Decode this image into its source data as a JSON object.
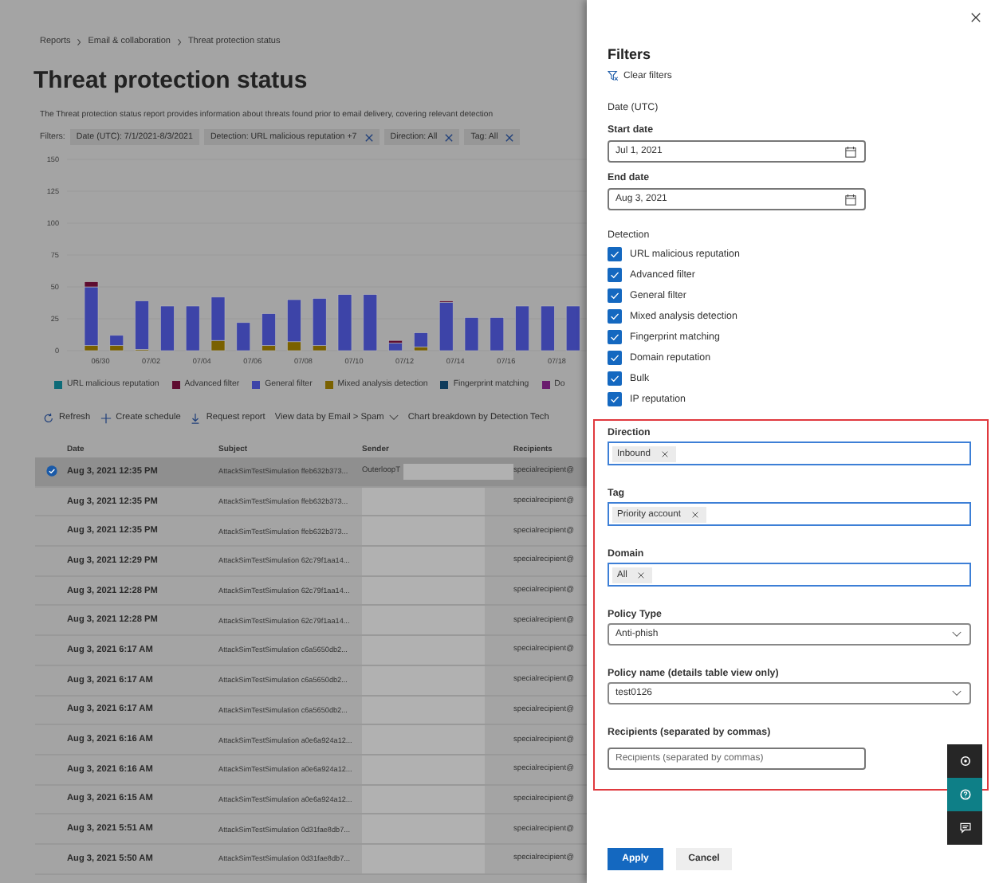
{
  "breadcrumb": [
    "Reports",
    "Email & collaboration",
    "Threat protection status"
  ],
  "page": {
    "title": "Threat protection status",
    "description": "The Threat protection status report provides information about threats found prior to email delivery, covering relevant detection"
  },
  "filters": {
    "label": "Filters:",
    "chips": [
      {
        "label": "Date (UTC): 7/1/2021-8/3/2021",
        "removable": false
      },
      {
        "label": "Detection: URL malicious reputation +7",
        "removable": true
      },
      {
        "label": "Direction: All",
        "removable": true
      },
      {
        "label": "Tag: All",
        "removable": true
      }
    ]
  },
  "chart": {
    "chart_data": {
      "type": "bar",
      "stacked": true,
      "categories": [
        "06/30",
        null,
        "07/02",
        null,
        "07/04",
        null,
        "07/06",
        null,
        "07/08",
        null,
        "07/10",
        null,
        "07/12",
        null,
        "07/14",
        null,
        "07/16",
        null,
        "07/18",
        null
      ],
      "ylim": [
        0,
        150
      ],
      "yticks": [
        0,
        25,
        50,
        75,
        100,
        125,
        150
      ],
      "series": [
        {
          "name": "URL malicious reputation",
          "color": "#0e6b78",
          "values": [
            0,
            0,
            0,
            0,
            0,
            0,
            0,
            0,
            0,
            0,
            0,
            0,
            0,
            0,
            0,
            0,
            0,
            0,
            0,
            0
          ]
        },
        {
          "name": "Advanced filter",
          "color": "#5e0c30",
          "values": [
            4,
            0,
            0,
            0,
            0,
            0,
            0,
            0,
            0,
            0,
            0,
            0,
            2,
            0,
            1,
            0,
            0,
            0,
            0,
            0
          ]
        },
        {
          "name": "General filter",
          "color": "#3d44a8",
          "values": [
            46,
            8,
            38,
            35,
            35,
            34,
            22,
            25,
            33,
            37,
            44,
            44,
            6,
            11,
            38,
            26,
            26,
            35,
            35,
            35
          ]
        },
        {
          "name": "Mixed analysis detection",
          "color": "#7a6100",
          "values": [
            4,
            4,
            1,
            0,
            0,
            8,
            0,
            4,
            7,
            4,
            0,
            0,
            0,
            3,
            0,
            0,
            0,
            0,
            0,
            0
          ]
        },
        {
          "name": "Fingerprint matching",
          "color": "#103c5c",
          "values": [
            0,
            0,
            0,
            0,
            0,
            0,
            0,
            0,
            0,
            0,
            0,
            0,
            0,
            0,
            0,
            0,
            0,
            0,
            0,
            0
          ]
        },
        {
          "name": "Do",
          "color": "#6a1c6e",
          "values": [
            0,
            0,
            0,
            0,
            0,
            0,
            0,
            0,
            0,
            0,
            0,
            0,
            0,
            0,
            0,
            0,
            0,
            0,
            0,
            0
          ]
        }
      ]
    }
  },
  "toolbar": [
    {
      "kind": "refresh",
      "label": "Refresh"
    },
    {
      "kind": "add",
      "label": "Create schedule"
    },
    {
      "kind": "download",
      "label": "Request report"
    },
    {
      "kind": "dropdown",
      "label": "View data by Email > Spam"
    },
    {
      "kind": "plain",
      "label": "Chart breakdown by Detection Tech"
    }
  ],
  "table": {
    "columns": [
      "Date",
      "Subject",
      "Sender",
      "Recipients"
    ],
    "rows": [
      {
        "selected": true,
        "date": "Aug 3, 2021 12:35 PM",
        "subject": "AttackSimTestSimulation ffeb632b373...",
        "sender": "OuterloopT",
        "recipients": "specialrecipient@"
      },
      {
        "selected": false,
        "date": "Aug 3, 2021 12:35 PM",
        "subject": "AttackSimTestSimulation ffeb632b373...",
        "recipients": "specialrecipient@"
      },
      {
        "selected": false,
        "date": "Aug 3, 2021 12:35 PM",
        "subject": "AttackSimTestSimulation ffeb632b373...",
        "recipients": "specialrecipient@"
      },
      {
        "selected": false,
        "date": "Aug 3, 2021 12:29 PM",
        "subject": "AttackSimTestSimulation 62c79f1aa14...",
        "recipients": "specialrecipient@"
      },
      {
        "selected": false,
        "date": "Aug 3, 2021 12:28 PM",
        "subject": "AttackSimTestSimulation 62c79f1aa14...",
        "recipients": "specialrecipient@"
      },
      {
        "selected": false,
        "date": "Aug 3, 2021 12:28 PM",
        "subject": "AttackSimTestSimulation 62c79f1aa14...",
        "recipients": "specialrecipient@"
      },
      {
        "selected": false,
        "date": "Aug 3, 2021 6:17 AM",
        "subject": "AttackSimTestSimulation c6a5650db2...",
        "recipients": "specialrecipient@"
      },
      {
        "selected": false,
        "date": "Aug 3, 2021 6:17 AM",
        "subject": "AttackSimTestSimulation c6a5650db2...",
        "recipients": "specialrecipient@"
      },
      {
        "selected": false,
        "date": "Aug 3, 2021 6:17 AM",
        "subject": "AttackSimTestSimulation c6a5650db2...",
        "recipients": "specialrecipient@"
      },
      {
        "selected": false,
        "date": "Aug 3, 2021 6:16 AM",
        "subject": "AttackSimTestSimulation a0e6a924a12...",
        "recipients": "specialrecipient@"
      },
      {
        "selected": false,
        "date": "Aug 3, 2021 6:16 AM",
        "subject": "AttackSimTestSimulation a0e6a924a12...",
        "recipients": "specialrecipient@"
      },
      {
        "selected": false,
        "date": "Aug 3, 2021 6:15 AM",
        "subject": "AttackSimTestSimulation a0e6a924a12...",
        "recipients": "specialrecipient@"
      },
      {
        "selected": false,
        "date": "Aug 3, 2021 5:51 AM",
        "subject": "AttackSimTestSimulation 0d31fae8db7...",
        "recipients": "specialrecipient@"
      },
      {
        "selected": false,
        "date": "Aug 3, 2021 5:50 AM",
        "subject": "AttackSimTestSimulation 0d31fae8db7...",
        "recipients": "specialrecipient@"
      }
    ]
  },
  "filter_panel": {
    "title": "Filters",
    "clear_label": "Clear filters",
    "date_section": "Date (UTC)",
    "start_date": {
      "label": "Start date",
      "value": "Jul 1, 2021"
    },
    "end_date": {
      "label": "End date",
      "value": "Aug 3, 2021"
    },
    "detection": {
      "label": "Detection",
      "options": [
        {
          "label": "URL malicious reputation",
          "checked": true
        },
        {
          "label": "Advanced filter",
          "checked": true
        },
        {
          "label": "General filter",
          "checked": true
        },
        {
          "label": "Mixed analysis detection",
          "checked": true
        },
        {
          "label": "Fingerprint matching",
          "checked": true
        },
        {
          "label": "Domain reputation",
          "checked": true
        },
        {
          "label": "Bulk",
          "checked": true
        },
        {
          "label": "IP reputation",
          "checked": true
        }
      ]
    },
    "highlighted_fields": [
      {
        "kind": "tags",
        "label": "Direction",
        "tags": [
          "Inbound"
        ]
      },
      {
        "kind": "tags",
        "label": "Tag",
        "tags": [
          "Priority account"
        ]
      },
      {
        "kind": "tags",
        "label": "Domain",
        "tags": [
          "All"
        ]
      },
      {
        "kind": "select",
        "label": "Policy Type",
        "value": "Anti-phish"
      },
      {
        "kind": "select",
        "label": "Policy name (details table view only)",
        "value": "test0126"
      },
      {
        "kind": "text",
        "label": "Recipients (separated by commas)",
        "placeholder": "Recipients (separated by commas)"
      }
    ],
    "buttons": [
      {
        "label": "Apply",
        "primary": true
      },
      {
        "label": "Cancel",
        "primary": false
      }
    ]
  },
  "floating_toolbar": [
    {
      "kind": "settings",
      "selected": false
    },
    {
      "kind": "help",
      "selected": true
    },
    {
      "kind": "chat",
      "selected": false
    }
  ]
}
